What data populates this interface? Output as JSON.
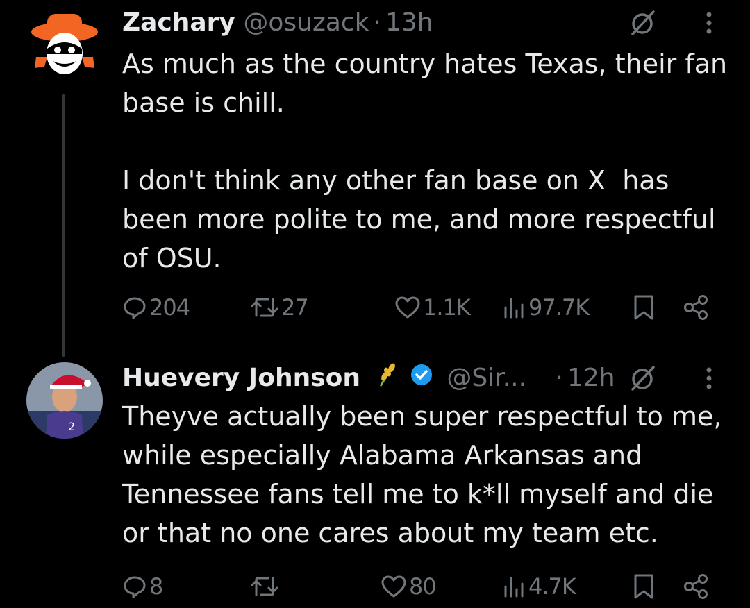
{
  "tweets": [
    {
      "author_name": "Zachary",
      "handle": "@osuzack",
      "separator": "·",
      "time": "13h",
      "text": "As much as the country hates Texas, their fan\nbase is chill.\n\nI don't think any other fan base on X  has\nbeen more polite to me, and more respectful\nof OSU.",
      "replies": "204",
      "reposts": "27",
      "likes": "1.1K",
      "views": "97.7K"
    },
    {
      "author_name": "Huevery Johnson",
      "handle": "@Sir...",
      "separator": "·",
      "time": "12h",
      "verified": true,
      "text": "Theyve actually been super respectful to me,\nwhile especially Alabama Arkansas and\nTennessee fans tell me to k*ll myself and die\nor that no one cares about my team etc.",
      "replies": "8",
      "reposts": "",
      "likes": "80",
      "views": "4.7K"
    }
  ],
  "colors": {
    "background": "#000000",
    "primary_text": "#e7e9ea",
    "secondary_text": "#71767b",
    "verified_badge": "#1d9bf0",
    "avatar_orange": "#f26522"
  }
}
